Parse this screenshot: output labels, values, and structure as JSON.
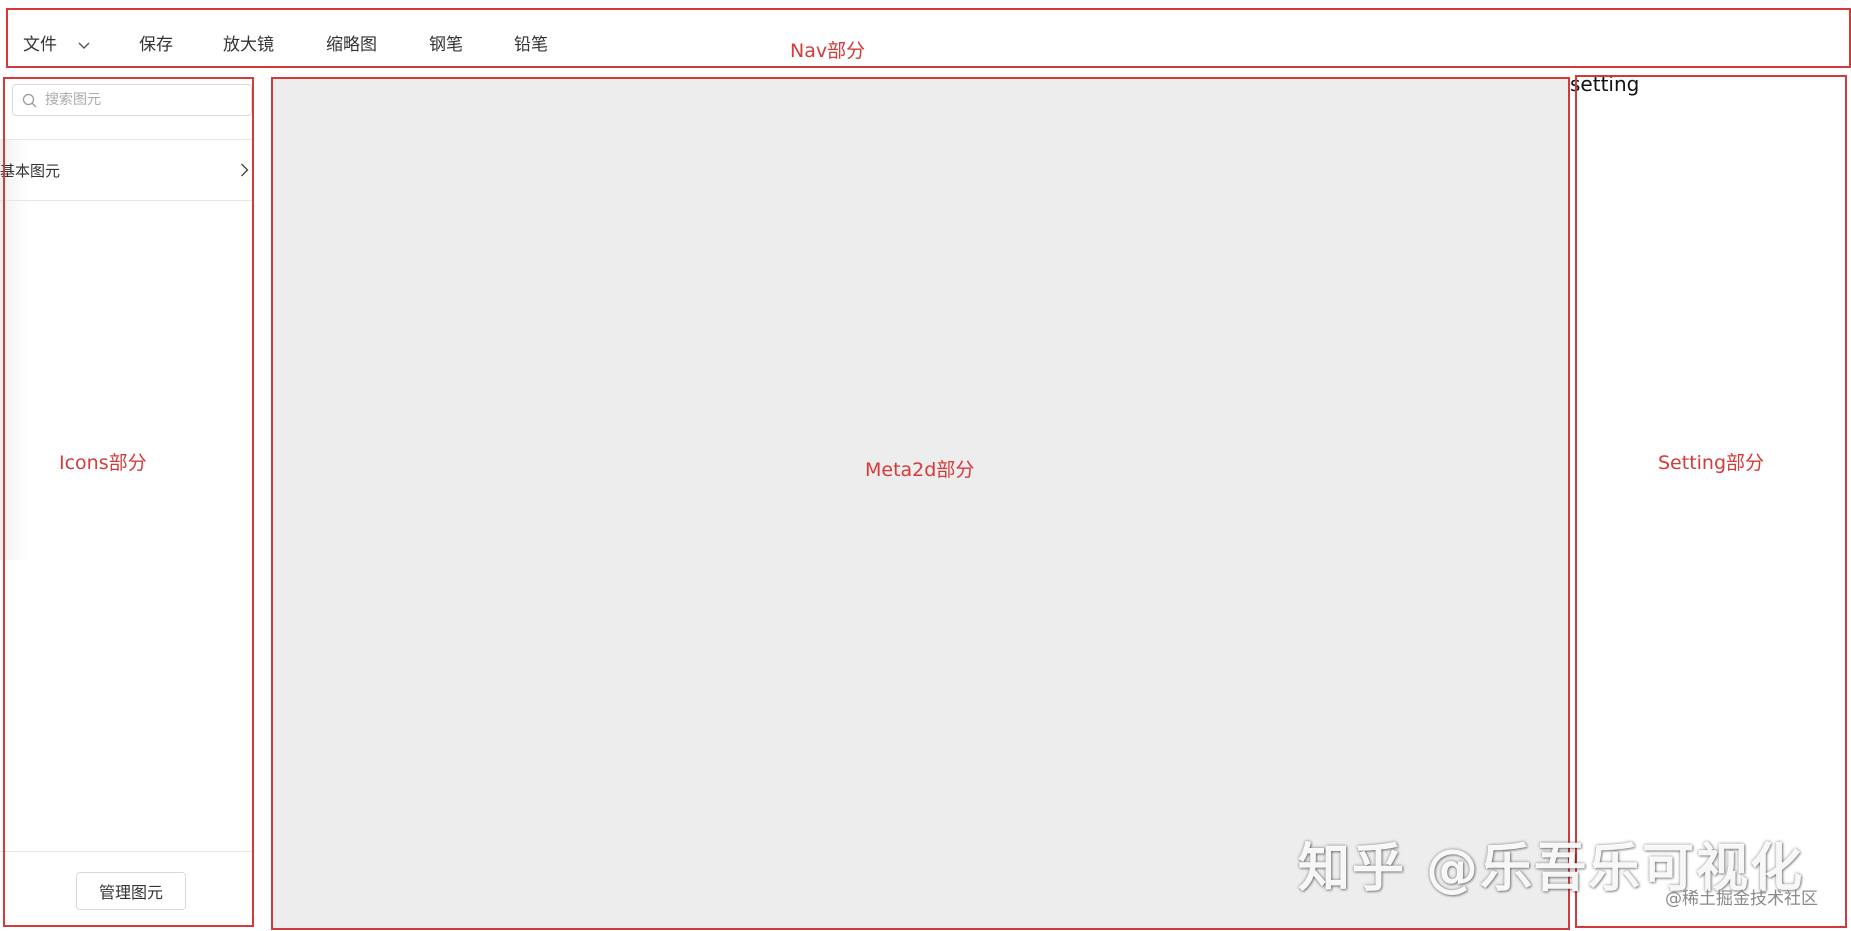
{
  "nav": {
    "menu": [
      {
        "label": "文件",
        "has_dropdown": true
      },
      {
        "label": "保存"
      },
      {
        "label": "放大镜"
      },
      {
        "label": "缩略图"
      },
      {
        "label": "钢笔"
      },
      {
        "label": "铅笔"
      }
    ],
    "region_label": "Nav部分"
  },
  "icons_panel": {
    "search_placeholder": "搜索图元",
    "category": {
      "label": "基本图元"
    },
    "manage_button": "管理图元",
    "region_label": "Icons部分"
  },
  "canvas": {
    "region_label": "Meta2d部分",
    "background_color": "#ededed"
  },
  "setting": {
    "title": "setting",
    "region_label": "Setting部分"
  },
  "watermark": {
    "main": "知乎 @乐吾乐可视化",
    "sub": "@稀土掘金技术社区"
  },
  "colors": {
    "annotation_red": "#d43a3a"
  },
  "icons": [
    "chevron-down-icon",
    "search-icon",
    "chevron-right-icon"
  ]
}
